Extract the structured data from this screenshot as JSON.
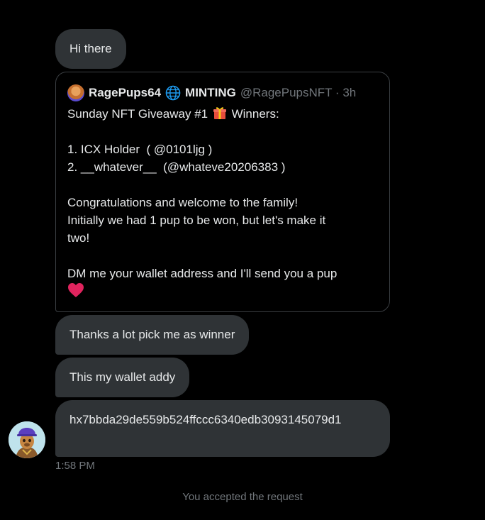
{
  "messages": {
    "m1": "Hi there",
    "m3": "Thanks a lot pick me as winner",
    "m4": "This my wallet addy",
    "m5": "hx7bbda29de559b524ffccc6340edb3093145079d1"
  },
  "quoted_tweet": {
    "author_name": "RagePups64",
    "author_suffix": "MINTING",
    "handle_time": "@RagePupsNFT · 3h",
    "lines": [
      "Sunday NFT Giveaway #1",
      "Winners:",
      "1. ICX Holder  ( @0101ljg )",
      "2. __whatever__  (@whateve20206383 )",
      "Congratulations and welcome to the family!",
      "Initially we had 1 pup to be won, but let's make it",
      "two!",
      "DM me your wallet address and I'll send you a pup"
    ]
  },
  "timestamp": "1:58 PM",
  "status": "You accepted the request",
  "icons": {
    "globe": "globe-icon",
    "gift": "gift-icon",
    "heart": "heart-icon"
  },
  "colors": {
    "background": "#000000",
    "bubble": "#2f3336",
    "text": "#e7e9ea",
    "muted": "#71767b",
    "heart": "#e0245e",
    "globe": "#1d9bf0"
  }
}
